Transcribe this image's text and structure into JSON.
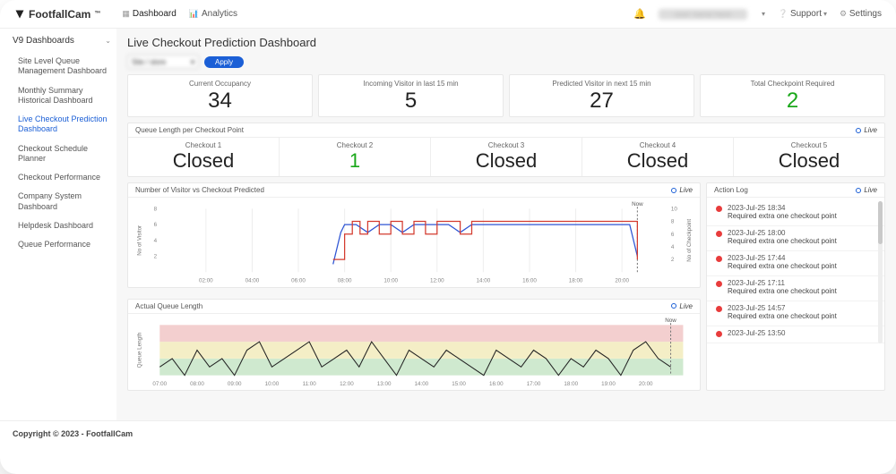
{
  "brand": "FootfallCam",
  "topnav": {
    "dashboard": "Dashboard",
    "analytics": "Analytics"
  },
  "topright": {
    "support": "Support",
    "settings": "Settings",
    "user_placeholder": "user name here"
  },
  "sidebar": {
    "group": "V9 Dashboards",
    "items": [
      "Site Level Queue Management Dashboard",
      "Monthly Summary Historical Dashboard",
      "Live Checkout Prediction Dashboard",
      "Checkout Schedule Planner",
      "Checkout Performance",
      "Company System Dashboard",
      "Helpdesk Dashboard",
      "Queue Performance"
    ],
    "active_index": 2
  },
  "page": {
    "title": "Live Checkout Prediction Dashboard",
    "apply_label": "Apply",
    "select_placeholder": "Site / store"
  },
  "kpis": [
    {
      "label": "Current Occupancy",
      "value": "34"
    },
    {
      "label": "Incoming Visitor in last 15 min",
      "value": "5"
    },
    {
      "label": "Predicted Visitor in next 15 min",
      "value": "27"
    },
    {
      "label": "Total Checkpoint Required",
      "value": "2",
      "green": true
    }
  ],
  "queue_panel": {
    "title": "Queue Length per Checkout Point",
    "live": "Live",
    "checkouts": [
      {
        "label": "Checkout 1",
        "value": "Closed"
      },
      {
        "label": "Checkout 2",
        "value": "1",
        "green": true
      },
      {
        "label": "Checkout 3",
        "value": "Closed"
      },
      {
        "label": "Checkout 4",
        "value": "Closed"
      },
      {
        "label": "Checkout 5",
        "value": "Closed"
      }
    ]
  },
  "chart1": {
    "title": "Number of Visitor vs Checkout Predicted",
    "live": "Live",
    "ylabel_left": "No of Visitor",
    "ylabel_right": "No of Checkpoint",
    "now_label": "Now"
  },
  "chart2": {
    "title": "Actual Queue Length",
    "live": "Live",
    "ylabel": "Queue Length",
    "now_label": "Now"
  },
  "action_log": {
    "title": "Action Log",
    "live": "Live",
    "items": [
      {
        "time": "2023-Jul-25 18:34",
        "msg": "Required extra one checkout point"
      },
      {
        "time": "2023-Jul-25 18:00",
        "msg": "Required extra one checkout point"
      },
      {
        "time": "2023-Jul-25 17:44",
        "msg": "Required extra one checkout point"
      },
      {
        "time": "2023-Jul-25 17:11",
        "msg": "Required extra one checkout point"
      },
      {
        "time": "2023-Jul-25 14:57",
        "msg": "Required extra one checkout point"
      },
      {
        "time": "2023-Jul-25 13:50",
        "msg": ""
      }
    ]
  },
  "chart_data": [
    {
      "type": "line",
      "title": "Number of Visitor vs Checkout Predicted",
      "x_ticks": [
        "02:00",
        "04:00",
        "06:00",
        "08:00",
        "10:00",
        "12:00",
        "14:00",
        "16:00",
        "18:00",
        "20:00"
      ],
      "y_left_range": [
        0,
        8
      ],
      "y_left_ticks": [
        2,
        4,
        6,
        8
      ],
      "y_right_range": [
        0,
        10
      ],
      "y_right_ticks": [
        2,
        4,
        6,
        8,
        10
      ],
      "now_x": "20:40",
      "series": [
        {
          "name": "No of Visitor",
          "color": "#2f55d4",
          "axis": "left",
          "points": [
            [
              "07:30",
              1
            ],
            [
              "07:40",
              3
            ],
            [
              "07:50",
              5
            ],
            [
              "08:00",
              6
            ],
            [
              "08:30",
              6
            ],
            [
              "09:00",
              5
            ],
            [
              "09:30",
              6
            ],
            [
              "10:00",
              6
            ],
            [
              "10:30",
              5
            ],
            [
              "11:00",
              6
            ],
            [
              "11:30",
              6
            ],
            [
              "12:00",
              6
            ],
            [
              "12:30",
              6
            ],
            [
              "13:00",
              5
            ],
            [
              "13:30",
              6
            ],
            [
              "14:00",
              6
            ],
            [
              "14:30",
              6
            ],
            [
              "15:00",
              6
            ],
            [
              "15:30",
              6
            ],
            [
              "16:00",
              6
            ],
            [
              "16:30",
              6
            ],
            [
              "17:00",
              6
            ],
            [
              "17:30",
              6
            ],
            [
              "18:00",
              6
            ],
            [
              "18:30",
              6
            ],
            [
              "19:00",
              6
            ],
            [
              "19:30",
              6
            ],
            [
              "20:00",
              6
            ],
            [
              "20:20",
              6
            ],
            [
              "20:40",
              2
            ]
          ]
        },
        {
          "name": "No of Checkpoint",
          "color": "#d43b2f",
          "axis": "right",
          "style": "step",
          "points": [
            [
              "07:30",
              2
            ],
            [
              "08:00",
              6
            ],
            [
              "08:20",
              8
            ],
            [
              "08:40",
              6
            ],
            [
              "09:00",
              8
            ],
            [
              "09:30",
              6
            ],
            [
              "10:00",
              8
            ],
            [
              "10:30",
              6
            ],
            [
              "11:00",
              8
            ],
            [
              "11:30",
              6
            ],
            [
              "12:00",
              8
            ],
            [
              "12:30",
              8
            ],
            [
              "13:00",
              6
            ],
            [
              "13:30",
              8
            ],
            [
              "14:00",
              8
            ],
            [
              "14:30",
              8
            ],
            [
              "15:00",
              8
            ],
            [
              "15:30",
              8
            ],
            [
              "16:00",
              8
            ],
            [
              "16:30",
              8
            ],
            [
              "17:00",
              8
            ],
            [
              "17:30",
              8
            ],
            [
              "18:00",
              8
            ],
            [
              "18:30",
              8
            ],
            [
              "19:00",
              8
            ],
            [
              "19:30",
              8
            ],
            [
              "20:00",
              8
            ],
            [
              "20:20",
              8
            ],
            [
              "20:40",
              2
            ]
          ]
        }
      ]
    },
    {
      "type": "line",
      "title": "Actual Queue Length",
      "x_ticks": [
        "07:00",
        "08:00",
        "09:00",
        "10:00",
        "11:00",
        "12:00",
        "13:00",
        "14:00",
        "15:00",
        "16:00",
        "17:00",
        "18:00",
        "19:00",
        "20:00"
      ],
      "y_range": [
        0,
        6
      ],
      "bands": [
        {
          "from": 0,
          "to": 2,
          "color": "#cfe9cf"
        },
        {
          "from": 2,
          "to": 4,
          "color": "#f4eec6"
        },
        {
          "from": 4,
          "to": 6,
          "color": "#f3cfcf"
        }
      ],
      "now_x": "20:40",
      "series": [
        {
          "name": "Queue Length",
          "color": "#222",
          "points": [
            [
              "07:00",
              1
            ],
            [
              "07:20",
              2
            ],
            [
              "07:40",
              0
            ],
            [
              "08:00",
              3
            ],
            [
              "08:20",
              1
            ],
            [
              "08:40",
              2
            ],
            [
              "09:00",
              0
            ],
            [
              "09:20",
              3
            ],
            [
              "09:40",
              4
            ],
            [
              "10:00",
              1
            ],
            [
              "10:20",
              2
            ],
            [
              "10:40",
              3
            ],
            [
              "11:00",
              4
            ],
            [
              "11:20",
              1
            ],
            [
              "11:40",
              2
            ],
            [
              "12:00",
              3
            ],
            [
              "12:20",
              1
            ],
            [
              "12:40",
              4
            ],
            [
              "13:00",
              2
            ],
            [
              "13:20",
              0
            ],
            [
              "13:40",
              3
            ],
            [
              "14:00",
              2
            ],
            [
              "14:20",
              1
            ],
            [
              "14:40",
              3
            ],
            [
              "15:00",
              2
            ],
            [
              "15:20",
              1
            ],
            [
              "15:40",
              0
            ],
            [
              "16:00",
              3
            ],
            [
              "16:20",
              2
            ],
            [
              "16:40",
              1
            ],
            [
              "17:00",
              3
            ],
            [
              "17:20",
              2
            ],
            [
              "17:40",
              0
            ],
            [
              "18:00",
              2
            ],
            [
              "18:20",
              1
            ],
            [
              "18:40",
              3
            ],
            [
              "19:00",
              2
            ],
            [
              "19:20",
              0
            ],
            [
              "19:40",
              3
            ],
            [
              "20:00",
              4
            ],
            [
              "20:20",
              2
            ],
            [
              "20:40",
              1
            ]
          ]
        }
      ]
    }
  ],
  "footer": "Copyright © 2023 - FootfallCam"
}
